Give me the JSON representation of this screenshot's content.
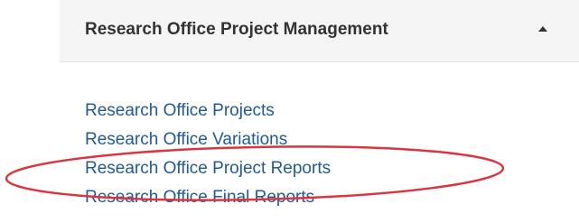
{
  "section": {
    "title": "Research Office Project Management",
    "expanded": true
  },
  "links": [
    {
      "label": "Research Office Projects"
    },
    {
      "label": "Research Office Variations"
    },
    {
      "label": "Research Office Project Reports",
      "highlighted": true
    },
    {
      "label": "Research Office Final Reports"
    }
  ],
  "colors": {
    "link": "#1f5a96",
    "header_bg": "#f5f5f5",
    "highlight": "#d9363e"
  },
  "icons": {
    "header_toggle": "caret-up-icon"
  }
}
